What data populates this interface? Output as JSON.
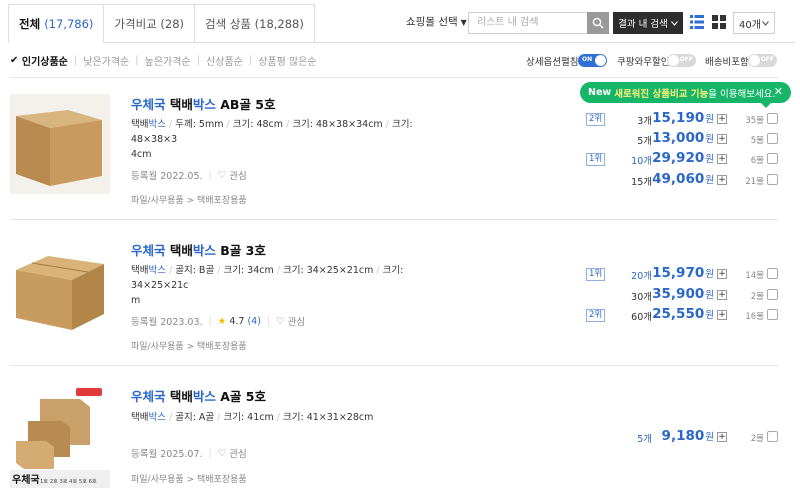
{
  "tabs": [
    {
      "label": "전체",
      "count": "(17,786)"
    },
    {
      "label": "가격비교",
      "count": "(28)"
    },
    {
      "label": "검색 상품",
      "count": "(18,288)"
    }
  ],
  "toolbar": {
    "mall_select": "쇼핑몰 선택",
    "search_placeholder": "리스트 내 검색",
    "search_in_results": "결과 내 검색",
    "per_page": "40개"
  },
  "sort": [
    "인기상품순",
    "낮은가격순",
    "높은가격순",
    "신상품순",
    "상품평 많은순"
  ],
  "toggles": [
    {
      "label": "상세옵션펼침",
      "state": "ON"
    },
    {
      "label": "쿠팡와우할인",
      "state": "OFF"
    },
    {
      "label": "배송비포함",
      "state": "OFF"
    }
  ],
  "tooltip": {
    "prefix": "New",
    "highlight": "새로워진 상품비교 기능",
    "suffix": "을 이용해보세요."
  },
  "products": [
    {
      "title": [
        "우체국",
        " 택배",
        "박스",
        " AB골 5호"
      ],
      "spec": [
        "택배",
        "박스",
        "두께: 5mm",
        "크기: 48cm",
        "크기: 48×38×34cm",
        "크기: 48×38×3",
        "4cm"
      ],
      "registered": "등록월 2022.05.",
      "wish": "관심",
      "category": "파일/사무용품 > 택배포장용품",
      "prices": [
        {
          "rank": "2위",
          "qty": "3개",
          "price": "15,190",
          "unit": "원",
          "malls": "35몰"
        },
        {
          "rank": "",
          "qty": "5개",
          "price": "13,000",
          "unit": "원",
          "malls": "5몰"
        },
        {
          "rank": "1위",
          "qty": "10개",
          "price": "29,920",
          "unit": "원",
          "malls": "6몰"
        },
        {
          "rank": "",
          "qty": "15개",
          "price": "49,060",
          "unit": "원",
          "malls": "21몰"
        }
      ]
    },
    {
      "title": [
        "우체국",
        " 택배",
        "박스",
        " B골 3호"
      ],
      "spec": [
        "택배",
        "박스",
        "골지: B골",
        "크기: 34cm",
        "크기: 34×25×21cm",
        "크기: 34×25×21c",
        "m"
      ],
      "registered": "등록월 2023.03.",
      "rating": "4.7",
      "reviews": "(4)",
      "wish": "관심",
      "category": "파일/사무용품 > 택배포장용품",
      "prices": [
        {
          "rank": "1위",
          "qty": "20개",
          "price": "15,970",
          "unit": "원",
          "malls": "14몰"
        },
        {
          "rank": "",
          "qty": "30개",
          "price": "35,900",
          "unit": "원",
          "malls": "2몰"
        },
        {
          "rank": "2위",
          "qty": "60개",
          "price": "25,550",
          "unit": "원",
          "malls": "16몰"
        }
      ]
    },
    {
      "title": [
        "우체국",
        " 택배",
        "박스",
        " A골 5호"
      ],
      "spec": [
        "택배",
        "박스",
        "골지: A골",
        "크기: 41cm",
        "크기: 41×31×28cm"
      ],
      "registered": "등록월 2025.07.",
      "wish": "관심",
      "category": "파일/사무용품 > 택배포장용품",
      "thumb_caption": "우체국",
      "thumb_sizes": "1호 2호 3호 4호 5호 6호",
      "prices": [
        {
          "rank": "",
          "qty": "5개",
          "price": "9,180",
          "unit": "원",
          "malls": "2몰"
        }
      ]
    }
  ],
  "colors": {
    "accent": "#2a67c9",
    "tooltip": "#17b568",
    "box": "#c9a06a"
  }
}
